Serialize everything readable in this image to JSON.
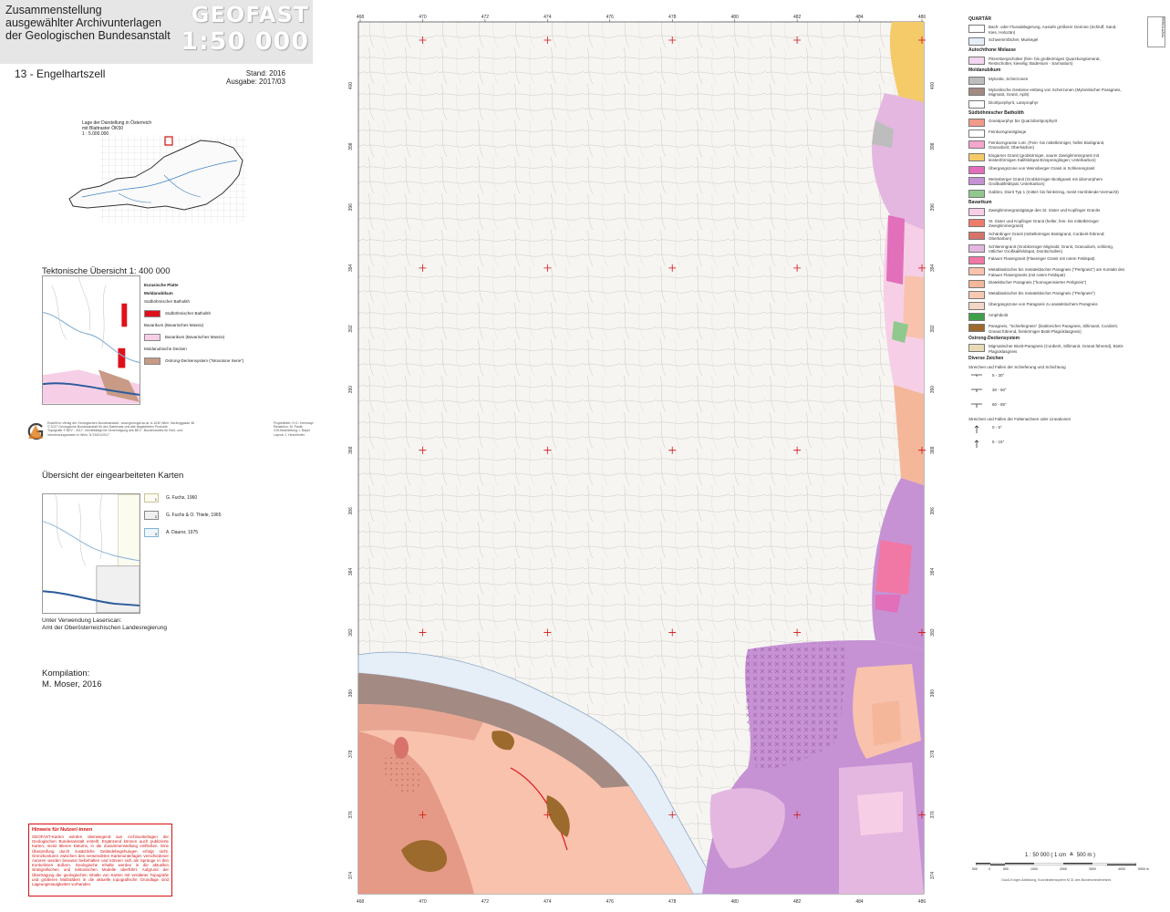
{
  "header": {
    "title_lines": [
      "Zusammenstellung",
      "ausgewählter Archivunterlagen",
      "der Geologischen Bundesanstalt"
    ],
    "series_line1": "GEOFAST",
    "series_line2": "1:50 000",
    "sheet": "13 - Engelhartszell",
    "stand": "Stand: 2016",
    "ausgabe": "Ausgabe: 2017/03"
  },
  "location_map": {
    "caption_lines": [
      "Lage der Darstellung in Österreich",
      "mit Blattraster ÖK50",
      "1 : 5.000.000"
    ]
  },
  "tectonic": {
    "title": "Tektonische Übersicht  1: 400 000",
    "legend": [
      {
        "kind": "head",
        "text": "Eurasische Platte"
      },
      {
        "kind": "head",
        "text": "Moldanubikum"
      },
      {
        "kind": "text",
        "text": "Südböhmischer Batholith"
      },
      {
        "kind": "item",
        "color": "#e0101a",
        "text": "Südböhmischer Batholith"
      },
      {
        "kind": "text",
        "text": "Bavarikum (Bavarisches Massiv)"
      },
      {
        "kind": "item",
        "color": "#f6cfe6",
        "text": "Bavarikum (Bavarisches Massiv)"
      },
      {
        "kind": "text",
        "text": "Moldanubische Decken"
      },
      {
        "kind": "item",
        "color": "#c99a86",
        "text": "Ostrong-Deckensystem (\"Monotone Serie\")"
      }
    ]
  },
  "credits": {
    "left_lines": [
      "Erstellt im Verlag der Geologischen Bundesanstalt - www.geologie.ac.at, A-1030 Wien, Neulinggasse 38",
      "© 2017 Geologische Bundesanstalt für den Datensatz und alle abgeleiteten Produkte",
      "Topografie © BEV - 2017, Vervielfältigt mit Genehmigung des BEV - Bundesamtes für Eich- und",
      "Vermessungswesen in Wien, N 23401/2017"
    ],
    "right_lines": [
      "Projektleiter: H.G. Krenmayr",
      "Redaktion: M. Pavlik",
      "GIS-Bearbeitung: I. Bayer",
      "Layout: J. Hirschhofer"
    ]
  },
  "overview": {
    "title": "Übersicht der eingearbeiteten Karten",
    "items": [
      {
        "num": "1",
        "label": "G. Fuchs, 1960",
        "fill": "#fbfbf0",
        "border": "#c8c49a"
      },
      {
        "num": "2",
        "label": "G. Fuchs & O. Thiele, 1965",
        "fill": "#f0f0f0",
        "border": "#888888"
      },
      {
        "num": "3",
        "label": "A. Daurer, 1975",
        "fill": "#eef6fb",
        "border": "#7fb2d6"
      }
    ],
    "laser_line1": "Unter Verwendung Laserscan:",
    "laser_line2": "Amt der Oberösterreichischen Landesregierung"
  },
  "kompilation": {
    "label": "Kompilation:",
    "author": "M. Moser, 2016"
  },
  "user_note": {
    "title": "Hinweis für Nutzer/-innen",
    "text": "GEOFAST-Karten werden überwiegend aus Archivunterlagen der Geologischen Bundesanstalt erstellt. Ergänzend können auch publizierte Karten, meist älteren Datums, in die Zusammenstellung einfließen. Eine Überprüfung durch zusätzliche Geländebegehungen erfolgt nicht. Grenzkonturen zwischen den verwendeten Kartenunterlagen verschiedener Autoren werden bewusst beibehalten und können sich als Sprünge in den Konturlinien äußern. Geologische Inhalte werden in die aktuellen stratigrafischen und tektonischen Modelle überführt. Aufgrund der Übertragung der geologischen Inhalte von Karten mit veralteter Topografie und größeren Maßstäben in die aktuelle topografische Grundlage sind Lageungenauigkeiten vorhanden."
  },
  "map": {
    "grid_top": [
      "468",
      "470",
      "472",
      "474",
      "476",
      "478",
      "480",
      "482",
      "484",
      "486"
    ],
    "grid_bottom": [
      "468",
      "470",
      "472",
      "474",
      "476",
      "478",
      "480",
      "482",
      "484",
      "486"
    ],
    "grid_left": [
      "400",
      "398",
      "396",
      "394",
      "392",
      "390",
      "388",
      "386",
      "384",
      "382",
      "380",
      "378",
      "376",
      "374"
    ],
    "grid_right": [
      "400",
      "398",
      "396",
      "394",
      "392",
      "390",
      "388",
      "386",
      "384",
      "382",
      "380",
      "378",
      "376",
      "374"
    ]
  },
  "legend": {
    "sections": [
      {
        "head": "QUARTÄR",
        "items": [
          {
            "color": "#ffffff",
            "text": "Bach- oder Flussablagerung, Austufe größerer Gerinne (Schluff, Sand, Kies, Holozän)"
          },
          {
            "color": "#e6eef8",
            "text": "Schwemmfächer, Murkegel"
          }
        ]
      },
      {
        "head": "Autochthone Molasse",
        "items": [
          {
            "color": "#f2d6ef",
            "text": "Pitzenbergschotter (fein- bis grobkörniges Quarzkonglomerat, Restschotter, kieselig; Badenium - Sarmatium)"
          }
        ]
      },
      {
        "head": "Moldanubikum",
        "items": [
          {
            "color": "#bdbdbd",
            "text": "Mylonite, Scherzonen"
          },
          {
            "color": "#a38a82",
            "text": "Mylonitische Gesteine entlang von Scherzonen (Mylonitischer Paragneis, Migmatit, Granit, Aplit)"
          },
          {
            "color": "#ffffff",
            "text": "Dioritporphyrit, Lamprophyr"
          }
        ]
      },
      {
        "head": "Südböhmischer Batholith",
        "items": [
          {
            "color": "#f29a8a",
            "text": "Granitporphyr bis Quarzdioritporphyrit"
          },
          {
            "color": "#ffffff",
            "text": "Feinkorngranitgänge"
          },
          {
            "color": "#f4a6cf",
            "text": "Feinkorngranite s.str. (Fein- bis mittelkörniger, heller Biotitgranit, Granodiorit; Oberkarbon)"
          },
          {
            "color": "#f5cb6a",
            "text": "Eisgarner Granit (grobkörniger, saurer Zweiglimmergranit mit leistenförmigen Kalifeldspat-Einsprenglingen; Unterkarbon)"
          },
          {
            "color": "#e16fb9",
            "text": "Übergangszone von Weinsberger Granit in Schlierengranit"
          },
          {
            "color": "#c692d4",
            "text": "Weinsberger Granit (Grobkörniger Biotitgranit mit idiomorphem Großkalifeldspat; Unterkarbon)"
          },
          {
            "color": "#8fc98e",
            "text": "Gabbro, Diorit Typ 1 (mittel- bis feinkörnig, meist Hornblende-Vormacht)"
          }
        ]
      },
      {
        "head": "Bavarikum",
        "items": [
          {
            "color": "#f6cfe6",
            "text": "Zweiglimmergranitgänge des St. Sixter und Kopfinger Granits"
          },
          {
            "color": "#ef7b6a",
            "text": "St. Sixter und Kopfinger Granit (heller, fein- bis mittelkörniger Zweiglimmergranit)"
          },
          {
            "color": "#d7736a",
            "text": "Schärdinger Granit (mittelkörniger Biotitgranit, Cordierit-führend; Oberkarbon)"
          },
          {
            "color": "#e4b7e0",
            "text": "Schlierengranit (Grobkörniger Migmatit, Granit, Granodiorit, schlierig, rötlicher Großkalifeldspat, Dioritschollen)"
          },
          {
            "color": "#f178a4",
            "text": "Falauer Flasergranit (Flaseriger Granit mit rotem Feldspat)"
          },
          {
            "color": "#f9c2ad",
            "text": "Metablastischer bis metatektischer Paragneis (\"Perlgneis\") am Kontakt des Falauer Flasergranits (mit rotem Feldspat)"
          },
          {
            "color": "#f4b79a",
            "text": "Diatektischer Paragneis (\"homogenisierter Perlgneis\")"
          },
          {
            "color": "#f7c9b4",
            "text": "Metablastischer bis metatektischer Paragneis (\"Perlgneis\")"
          },
          {
            "color": "#f3d7c6",
            "text": "Übergangszone von Paragneis zu anatektischem Paragneis"
          },
          {
            "color": "#3ea04a",
            "text": "Amphibolit"
          },
          {
            "color": "#9c6a2c",
            "text": "Paragneis, \"Schiefergneis\" (biotitreicher Paragneis, Sillimanit, Cordierit, Granat führend, feinkörniger Biotit-Plagioklasgneis)"
          }
        ]
      },
      {
        "head": "Ostrong-Deckensystem",
        "items": [
          {
            "color": "#e8dcb6",
            "text": "Migmatischer Biotit-Paragneis (Cordierit, Sillimanit, Granat führend), Biotit-Plagioklasgneis"
          }
        ]
      }
    ],
    "side_label": "PERIGLAZIAL",
    "diverse_head": "Diverse Zeichen",
    "strike_head": "Streichen und Fallen der Schieferung und Schichtung",
    "strike_items": [
      "5 - 30°",
      "30 - 60°",
      "60 - 85°"
    ],
    "fold_head": "Streichen und Fallen der Faltenachsen oder Lineationen",
    "fold_items": [
      "0 - 5°",
      "5 - 15°"
    ]
  },
  "scale": {
    "text": "1 : 50 000   ( 1 cm   ≙  500 m )",
    "ticks": [
      "500",
      "0",
      "500",
      "1000",
      "2000",
      "3000",
      "4000",
      "5000 m"
    ],
    "projection": "Gauß-Krüger-Abbildung, Koordinatensystem M 31 des Bundesmeldenetzes"
  },
  "colors": {
    "topo_bg": "#f6f5f2",
    "red_marks": "#d41111",
    "danube": "#e6eef8"
  }
}
